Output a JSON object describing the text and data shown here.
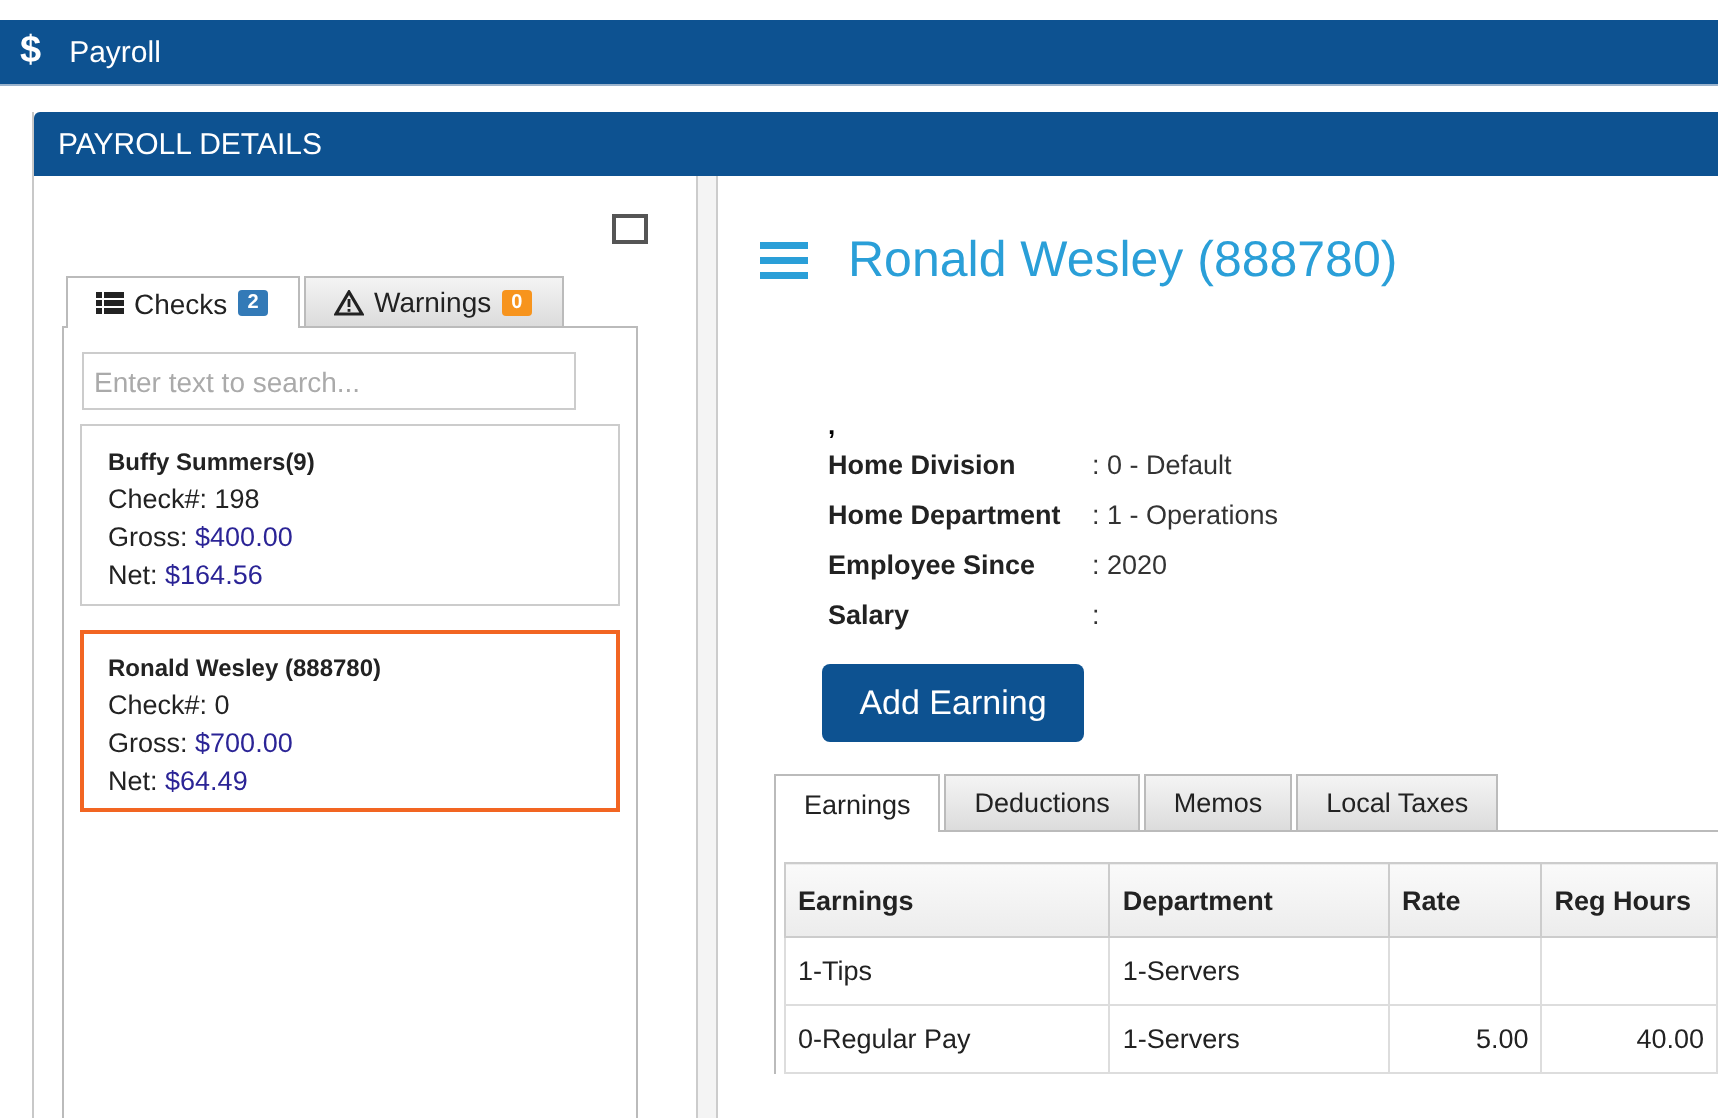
{
  "app_bar": {
    "icon_text": "$",
    "title": "Payroll"
  },
  "panel": {
    "title": "PAYROLL DETAILS"
  },
  "list_tabs": [
    {
      "label": "Checks",
      "count": "2",
      "kind": "checks",
      "selected": true
    },
    {
      "label": "Warnings",
      "count": "0",
      "kind": "warnings",
      "selected": false
    }
  ],
  "search": {
    "placeholder": "Enter text to search..."
  },
  "checks": [
    {
      "name": "Buffy Summers(9)",
      "check": "Check#: 198",
      "gross_label": "Gross:",
      "gross": "$400.00",
      "net_label": "Net:",
      "net": "$164.56",
      "selected": false
    },
    {
      "name": "Ronald Wesley (888780)",
      "check": "Check#: 0",
      "gross_label": "Gross:",
      "gross": "$700.00",
      "net_label": "Net:",
      "net": "$64.49",
      "selected": true
    }
  ],
  "employee": {
    "title": "Ronald Wesley (888780)",
    "address": ",",
    "fields": [
      {
        "label": "Home Division",
        "value": ": 0 - Default"
      },
      {
        "label": "Home Department",
        "value": ": 1 - Operations"
      },
      {
        "label": "Employee Since",
        "value": ": 2020"
      },
      {
        "label": "Salary",
        "value": ":"
      }
    ]
  },
  "add_button": "Add Earning",
  "detail_tabs": [
    {
      "label": "Earnings",
      "selected": true
    },
    {
      "label": "Deductions",
      "selected": false
    },
    {
      "label": "Memos",
      "selected": false
    },
    {
      "label": "Local Taxes",
      "selected": false
    }
  ],
  "table": {
    "columns": [
      "Earnings",
      "Department",
      "Rate",
      "Reg Hours"
    ],
    "rows": [
      [
        "1-Tips",
        "1-Servers",
        "",
        ""
      ],
      [
        "0-Regular Pay",
        "1-Servers",
        "5.00",
        "40.00"
      ]
    ]
  }
}
